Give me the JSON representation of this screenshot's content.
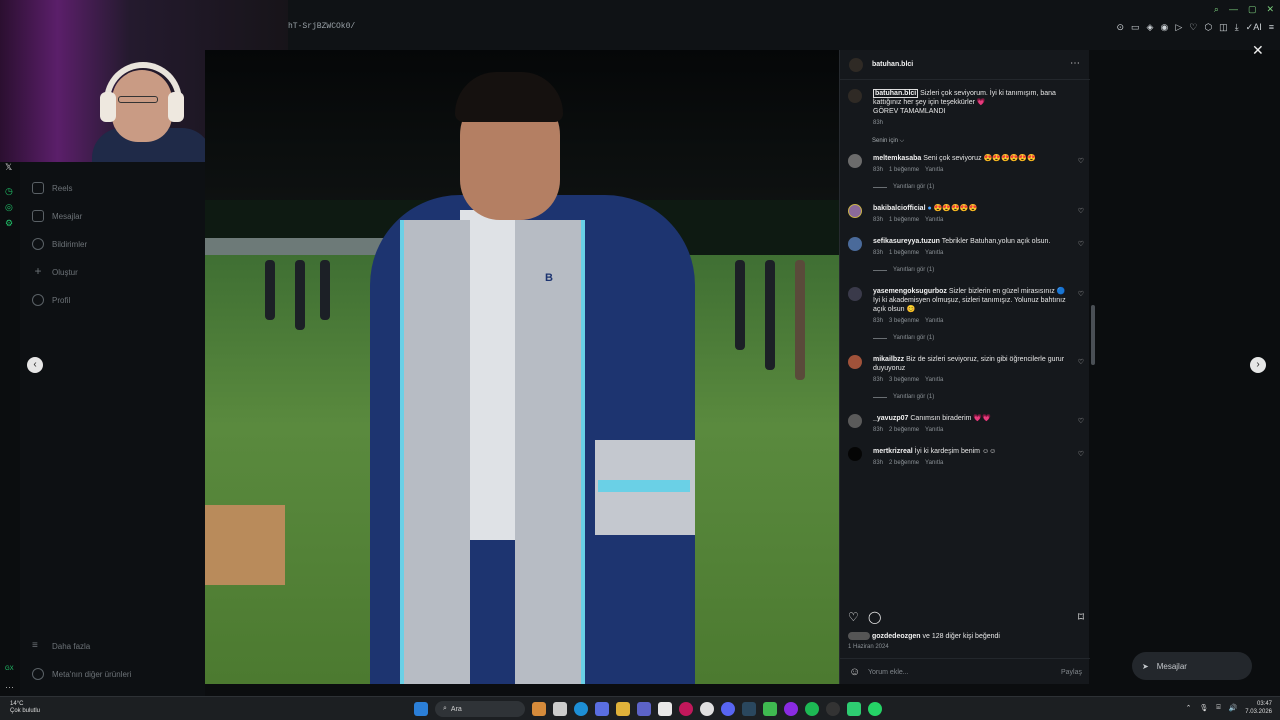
{
  "browser": {
    "url_fragment": "hT-SrjBZWCOk0/",
    "ai_label": "AI"
  },
  "sidebar": {
    "items": [
      {
        "label": "Reels",
        "icon": "reels-icon"
      },
      {
        "label": "Mesajlar",
        "icon": "send-icon"
      },
      {
        "label": "Bildirimler",
        "icon": "heart-icon"
      },
      {
        "label": "Oluştur",
        "icon": "plus-icon"
      },
      {
        "label": "Profil",
        "icon": "profile-icon"
      }
    ],
    "more_label": "Daha fazla",
    "meta_label": "Meta'nın diğer ürünleri"
  },
  "post": {
    "author": "batuhan.blci",
    "caption_user": "batuhan.blci",
    "caption_text": " Sizleri çok seviyorum. İyi ki tanımışım, bana kattığınız her şey için teşekkürler 💗",
    "caption_line2": "GÖREV TAMAMLANDI",
    "caption_time": "83h",
    "filter_label": "Senin için ⌵",
    "logo_text": "B"
  },
  "comments": [
    {
      "user": "meltemkasaba",
      "text": "Seni çok seviyoruz 😍😍😍😍😍😍",
      "time": "83h",
      "likes": "1 beğenme",
      "reply": "Yanıtla",
      "replies": "Yanıtları gör (1)"
    },
    {
      "user": "bakibalciofficial",
      "text": "😍😍😍😍😍",
      "time": "83h",
      "likes": "1 beğenme",
      "reply": "Yanıtla",
      "replies": ""
    },
    {
      "user": "sefikasureyya.tuzun",
      "text": "Tebrikler Batuhan,yolun açık olsun.",
      "time": "83h",
      "likes": "1 beğenme",
      "reply": "Yanıtla",
      "replies": "Yanıtları gör (1)"
    },
    {
      "user": "yasemengoksugurboz",
      "text": "Sizler bizlerin en güzel mirasısınız 🔵 İyi ki akademisyen olmuşuz, sizleri tanımışız. Yolunuz bahtınız açık olsun 😊",
      "time": "83h",
      "likes": "3 beğenme",
      "reply": "Yanıtla",
      "replies": "Yanıtları gör (1)"
    },
    {
      "user": "mikailbzz",
      "text": "Biz de sizleri seviyoruz, sizin gibi öğrencilerle gurur duyuyoruz",
      "time": "83h",
      "likes": "3 beğenme",
      "reply": "Yanıtla",
      "replies": "Yanıtları gör (1)"
    },
    {
      "user": "_yavuzp07",
      "text": "Canımsın biraderim 💗💗",
      "time": "83h",
      "likes": "2 beğenme",
      "reply": "Yanıtla",
      "replies": ""
    },
    {
      "user": "mertkrizreal",
      "text": "İyi ki kardeşim benim ☺☺",
      "time": "83h",
      "likes": "2 beğenme",
      "reply": "Yanıtla",
      "replies": ""
    }
  ],
  "footer": {
    "liked_by_user": "gozdedeozgen",
    "liked_by_rest": " ve 128 diğer kişi beğendi",
    "date": "1 Haziran 2024",
    "comment_placeholder": "Yorum ekle...",
    "post_label": "Paylaş"
  },
  "messages_pill": "Mesajlar",
  "taskbar": {
    "temp": "14°C",
    "weather": "Çok bulutlu",
    "search": "Ara",
    "time": "03:47",
    "date": "7.03.2026"
  },
  "colors": {
    "accent": "#21c46a",
    "panel_bg": "#15181c",
    "gown_blue": "#1d3470",
    "stole_trim": "#6ad0e6"
  }
}
